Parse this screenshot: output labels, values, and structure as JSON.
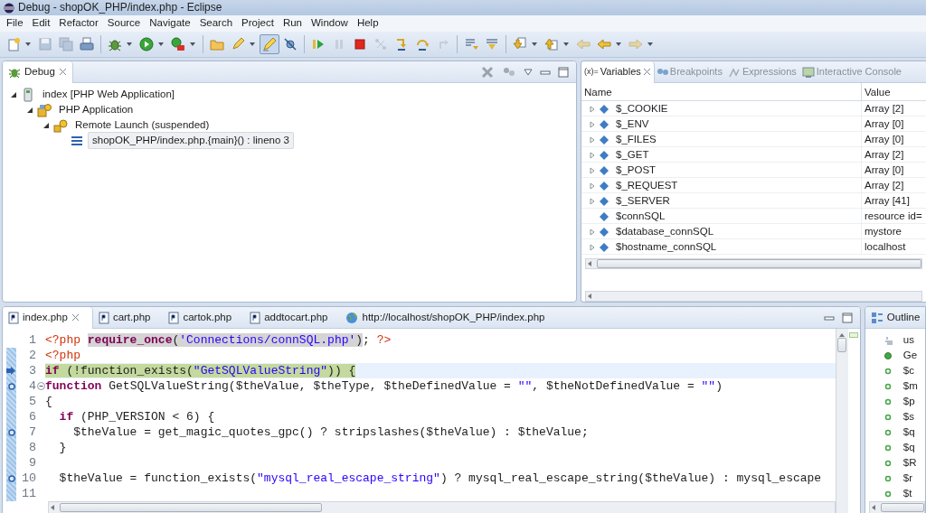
{
  "window": {
    "title": "Debug - shopOK_PHP/index.php - Eclipse"
  },
  "menu": [
    "File",
    "Edit",
    "Refactor",
    "Source",
    "Navigate",
    "Search",
    "Project",
    "Run",
    "Window",
    "Help"
  ],
  "toolbar": [
    {
      "kind": "new",
      "disabled": false,
      "dropdown": true
    },
    {
      "kind": "save",
      "disabled": true,
      "dropdown": false
    },
    {
      "kind": "save-all",
      "disabled": true,
      "dropdown": false
    },
    {
      "kind": "print",
      "disabled": false,
      "dropdown": false
    },
    {
      "kind": "separator"
    },
    {
      "kind": "debug",
      "disabled": false,
      "dropdown": true
    },
    {
      "kind": "run",
      "disabled": false,
      "dropdown": true
    },
    {
      "kind": "tools",
      "disabled": false,
      "dropdown": true
    },
    {
      "kind": "separator"
    },
    {
      "kind": "open",
      "disabled": false,
      "dropdown": false
    },
    {
      "kind": "marker",
      "disabled": false,
      "dropdown": true
    },
    {
      "kind": "highlight",
      "disabled": false,
      "dropdown": false,
      "pressed": true
    },
    {
      "kind": "skip",
      "disabled": false,
      "dropdown": false
    },
    {
      "kind": "separator"
    },
    {
      "kind": "resume",
      "disabled": false,
      "dropdown": false
    },
    {
      "kind": "suspend",
      "disabled": true,
      "dropdown": false
    },
    {
      "kind": "terminate",
      "disabled": false,
      "dropdown": false
    },
    {
      "kind": "disconnect",
      "disabled": true,
      "dropdown": false
    },
    {
      "kind": "step-into",
      "disabled": false,
      "dropdown": false
    },
    {
      "kind": "step-over",
      "disabled": false,
      "dropdown": false
    },
    {
      "kind": "step-return",
      "disabled": true,
      "dropdown": false
    },
    {
      "kind": "separator"
    },
    {
      "kind": "filter",
      "disabled": false,
      "dropdown": false
    },
    {
      "kind": "drop-frame",
      "disabled": false,
      "dropdown": false
    },
    {
      "kind": "separator"
    },
    {
      "kind": "next-annotation",
      "disabled": false,
      "dropdown": true
    },
    {
      "kind": "prev-annotation",
      "disabled": false,
      "dropdown": true
    },
    {
      "kind": "back",
      "disabled": true,
      "dropdown": false
    },
    {
      "kind": "back",
      "disabled": false,
      "dropdown": true
    },
    {
      "kind": "forward",
      "disabled": true,
      "dropdown": true
    }
  ],
  "debug_view": {
    "tab": "Debug",
    "tree": [
      {
        "label": "index [PHP Web Application]",
        "kind": "app",
        "expanded": true,
        "selected": false,
        "children": [
          {
            "label": "PHP Application",
            "kind": "launcher",
            "expanded": true,
            "selected": false,
            "children": [
              {
                "label": "Remote Launch (suspended)",
                "kind": "launch",
                "expanded": true,
                "selected": false,
                "children": [
                  {
                    "label": "shopOK_PHP/index.php.{main}() : lineno 3",
                    "kind": "frame",
                    "selected": true
                  }
                ]
              }
            ]
          }
        ]
      }
    ]
  },
  "variables_view": {
    "tabs": [
      {
        "label": "Variables",
        "prefix": "(x)=",
        "selected": true
      },
      {
        "label": "Breakpoints",
        "selected": false
      },
      {
        "label": "Expressions",
        "selected": false
      },
      {
        "label": "Interactive Console",
        "selected": false
      }
    ],
    "columns": [
      "Name",
      "Value"
    ],
    "rows": [
      {
        "name": "$_COOKIE",
        "value": "Array [2]",
        "expandable": true
      },
      {
        "name": "$_ENV",
        "value": "Array [0]",
        "expandable": true
      },
      {
        "name": "$_FILES",
        "value": "Array [0]",
        "expandable": true
      },
      {
        "name": "$_GET",
        "value": "Array [2]",
        "expandable": true
      },
      {
        "name": "$_POST",
        "value": "Array [0]",
        "expandable": true
      },
      {
        "name": "$_REQUEST",
        "value": "Array [2]",
        "expandable": true
      },
      {
        "name": "$_SERVER",
        "value": "Array [41]",
        "expandable": true
      },
      {
        "name": "$connSQL",
        "value": "resource id=",
        "expandable": false
      },
      {
        "name": "$database_connSQL",
        "value": "mystore",
        "expandable": true
      },
      {
        "name": "$hostname_connSQL",
        "value": "localhost",
        "expandable": true
      }
    ]
  },
  "editor": {
    "tabs": [
      {
        "label": "index.php",
        "kind": "php",
        "selected": true
      },
      {
        "label": "cart.php",
        "kind": "php",
        "selected": false
      },
      {
        "label": "cartok.php",
        "kind": "php",
        "selected": false
      },
      {
        "label": "addtocart.php",
        "kind": "php",
        "selected": false
      },
      {
        "label": "http://localhost/shopOK_PHP/index.php",
        "kind": "web",
        "selected": false
      }
    ],
    "lines": [
      {
        "number": "1",
        "breakpoint": false,
        "pointer": false,
        "current": false,
        "foldable": false,
        "tokens": [
          {
            "text": "<?php ",
            "kind": "tag"
          },
          {
            "kind": "occurrence",
            "tokens": [
              {
                "text": "require_once",
                "kind": "keyword"
              },
              {
                "text": "(",
                "kind": "plain"
              },
              {
                "text": "'Connections/connSQL.php'",
                "kind": "string"
              },
              {
                "text": ")",
                "kind": "plain"
              }
            ]
          },
          {
            "text": "; ",
            "kind": "plain"
          },
          {
            "text": "?>",
            "kind": "tag"
          }
        ]
      },
      {
        "number": "2",
        "breakpoint": false,
        "pointer": false,
        "current": false,
        "foldable": false,
        "tokens": [
          {
            "text": "<?php",
            "kind": "tag"
          }
        ]
      },
      {
        "number": "3",
        "breakpoint": false,
        "pointer": true,
        "current": true,
        "foldable": false,
        "tokens": [
          {
            "kind": "selection",
            "tokens": [
              {
                "text": "if",
                "kind": "keyword"
              },
              {
                "text": " (!function_exists(",
                "kind": "plain"
              },
              {
                "text": "\"GetSQLValueString\"",
                "kind": "string"
              },
              {
                "text": ")) {",
                "kind": "plain"
              }
            ]
          }
        ]
      },
      {
        "number": "4",
        "breakpoint": true,
        "pointer": false,
        "current": false,
        "foldable": true,
        "tokens": [
          {
            "text": "function",
            "kind": "keyword"
          },
          {
            "text": " GetSQLValueString($theValue, $theType, $theDefinedValue = ",
            "kind": "plain"
          },
          {
            "text": "\"\"",
            "kind": "string"
          },
          {
            "text": ", $theNotDefinedValue = ",
            "kind": "plain"
          },
          {
            "text": "\"\"",
            "kind": "string"
          },
          {
            "text": ")",
            "kind": "plain"
          }
        ]
      },
      {
        "number": "5",
        "breakpoint": false,
        "pointer": false,
        "current": false,
        "foldable": false,
        "tokens": [
          {
            "text": "{",
            "kind": "plain"
          }
        ]
      },
      {
        "number": "6",
        "breakpoint": false,
        "pointer": false,
        "current": false,
        "foldable": false,
        "tokens": [
          {
            "text": "  if",
            "kind": "keyword"
          },
          {
            "text": " (PHP_VERSION < 6) {",
            "kind": "plain"
          }
        ]
      },
      {
        "number": "7",
        "breakpoint": true,
        "pointer": false,
        "current": false,
        "foldable": false,
        "tokens": [
          {
            "text": "    $theValue = get_magic_quotes_gpc() ? stripslashes($theValue) : $theValue;",
            "kind": "plain"
          }
        ]
      },
      {
        "number": "8",
        "breakpoint": false,
        "pointer": false,
        "current": false,
        "foldable": false,
        "tokens": [
          {
            "text": "  }",
            "kind": "plain"
          }
        ]
      },
      {
        "number": "9",
        "breakpoint": false,
        "pointer": false,
        "current": false,
        "foldable": false
      },
      {
        "number": "10",
        "breakpoint": true,
        "pointer": false,
        "current": false,
        "foldable": false,
        "tokens": [
          {
            "text": "  $theValue = function_exists(",
            "kind": "plain"
          },
          {
            "text": "\"mysql_real_escape_string\"",
            "kind": "string"
          },
          {
            "text": ") ? mysql_real_escape_string($theValue) : mysql_escape",
            "kind": "plain"
          }
        ]
      },
      {
        "number": "11",
        "breakpoint": false,
        "pointer": false,
        "current": false,
        "foldable": false
      }
    ]
  },
  "outline_view": {
    "tab": "Outline",
    "items": [
      {
        "label": "us",
        "kind": "use"
      },
      {
        "label": "Ge",
        "kind": "function"
      },
      {
        "label": "$c",
        "kind": "variable"
      },
      {
        "label": "$m",
        "kind": "variable"
      },
      {
        "label": "$p",
        "kind": "variable"
      },
      {
        "label": "$s",
        "kind": "variable"
      },
      {
        "label": "$q",
        "kind": "variable"
      },
      {
        "label": "$q",
        "kind": "variable"
      },
      {
        "label": "$R",
        "kind": "variable"
      },
      {
        "label": "$r",
        "kind": "variable"
      },
      {
        "label": "$t",
        "kind": "variable"
      }
    ]
  }
}
